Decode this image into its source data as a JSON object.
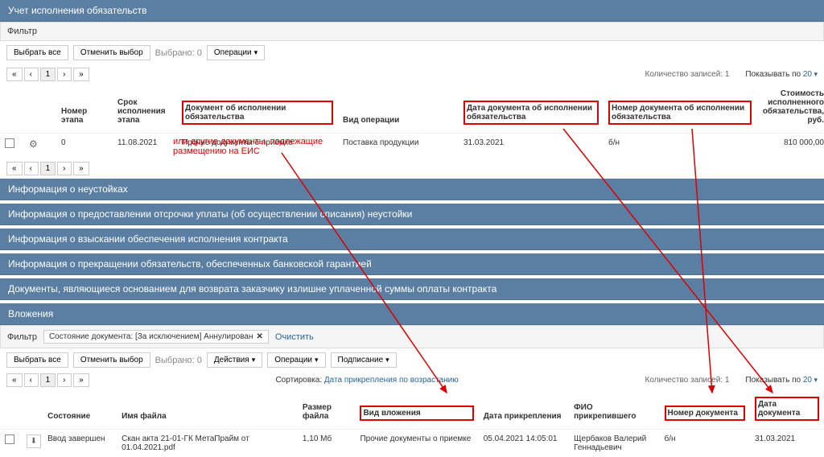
{
  "sections": {
    "main": "Учет исполнения обязательств",
    "penalties": "Информация о неустойках",
    "deferral": "Информация о предоставлении отсрочки уплаты (об осуществлении списания) неустойки",
    "collection": "Информация о взыскании обеспечения исполнения контракта",
    "termination": "Информация о прекращении обязательств, обеспеченных банковской гарантией",
    "refund": "Документы, являющиеся основанием для возврата заказчику излишне уплаченной суммы оплаты контракта",
    "attachments": "Вложения"
  },
  "filter": {
    "label": "Фильтр",
    "state_label": "Состояние документа: [За исключением] Аннулирован",
    "clear": "Очистить"
  },
  "toolbar": {
    "select_all": "Выбрать все",
    "deselect": "Отменить выбор",
    "selected": "Выбрано: 0",
    "operations": "Операции",
    "actions": "Действия",
    "signing": "Подписание"
  },
  "pager": {
    "prev": "‹",
    "page": "1",
    "next": "›",
    "first": "«",
    "last": "»"
  },
  "counts": {
    "records": "Количество записей: 1",
    "show_by": "Показывать по",
    "show_n": "20"
  },
  "table1": {
    "headers": {
      "stage": "Номер этапа",
      "deadline": "Срок исполнения этапа",
      "doc": "Документ об исполнении обязательства",
      "op": "Вид операции",
      "doc_date": "Дата документа об исполнении обязательства",
      "doc_num": "Номер документа об исполнении обязательства",
      "cost": "Стоимость исполненного обязательства, руб."
    },
    "row": {
      "stage": "0",
      "deadline": "11.08.2021",
      "doc": "Прочие документы о приемке",
      "op": "Поставка продукции",
      "doc_date": "31.03.2021",
      "doc_num": "б/н",
      "cost": "810 000,00"
    }
  },
  "annotation": {
    "line1": "или другие документы, подлежащие",
    "line2": "размещению на ЕИС"
  },
  "sort": {
    "label": "Сортировка:",
    "value": "Дата прикрепления по возрастанию"
  },
  "table2": {
    "headers": {
      "state": "Состояние",
      "filename": "Имя файла",
      "size": "Размер файла",
      "type": "Вид вложения",
      "attached": "Дата прикрепления",
      "user": "ФИО прикрепившего",
      "num": "Номер документа",
      "date": "Дата документа"
    },
    "row": {
      "state": "Ввод завершен",
      "filename": "Скан акта 21-01-ГК МетаПрайм от 01.04.2021.pdf",
      "size": "1,10 Мб",
      "type": "Прочие документы о приемке",
      "attached": "05.04.2021 14:05:01",
      "user": "Щербаков Валерий Геннадьевич",
      "num": "б/н",
      "date": "31.03.2021"
    }
  }
}
